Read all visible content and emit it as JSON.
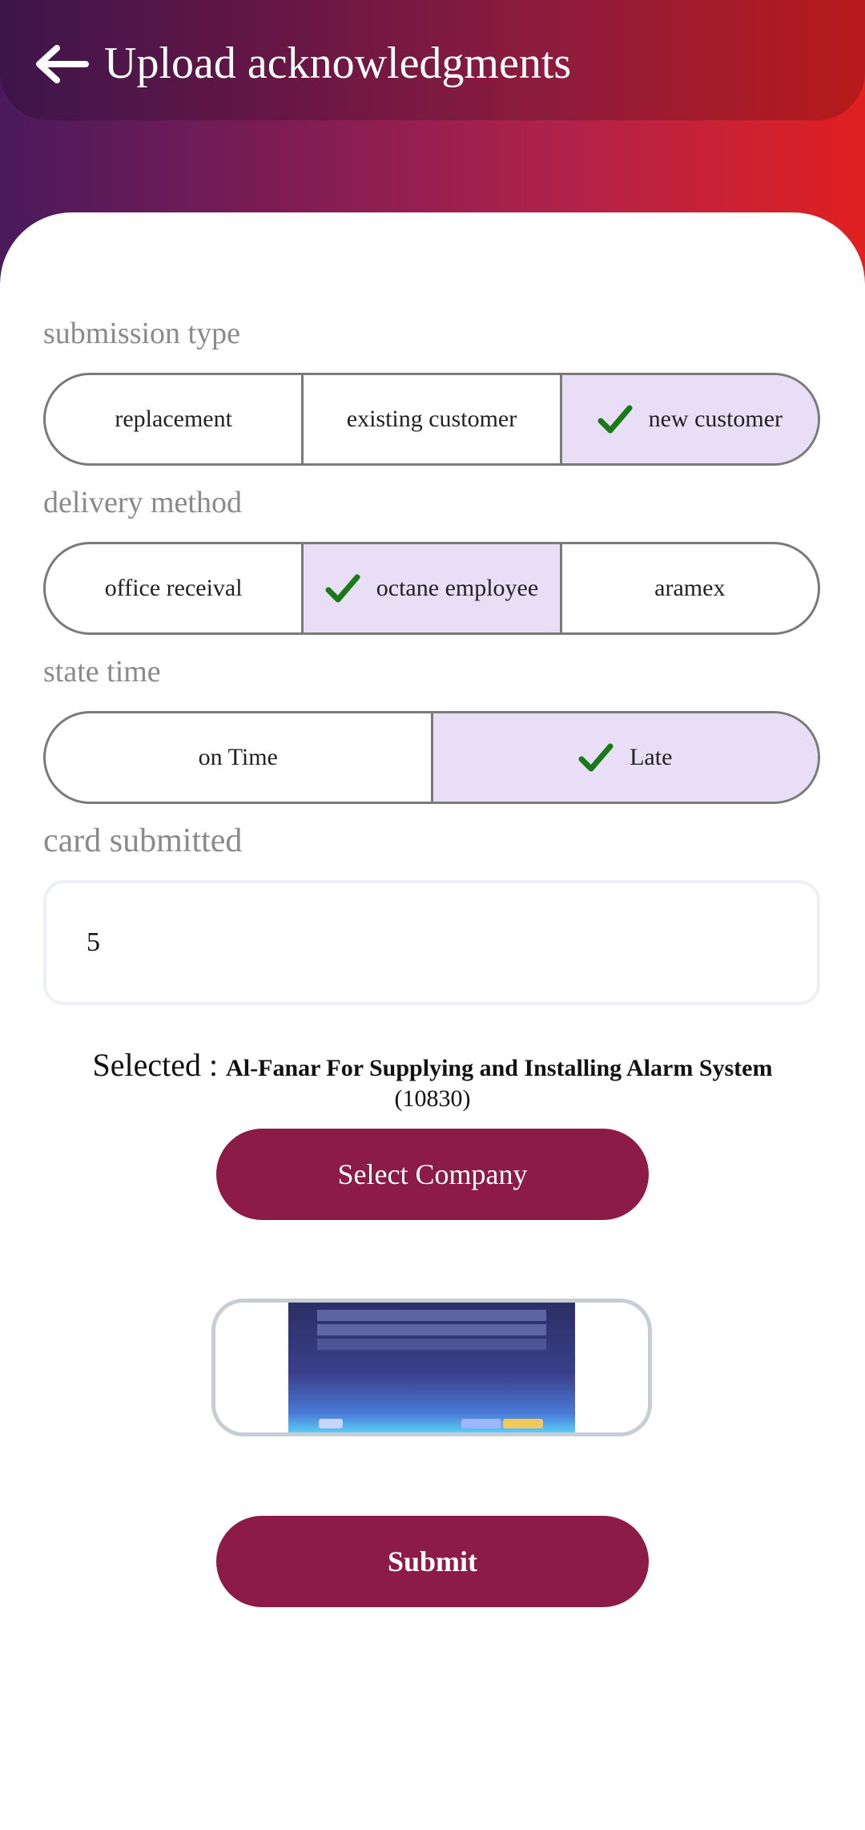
{
  "header": {
    "title": "Upload acknowledgments"
  },
  "icons": {
    "back": "arrow-left-icon",
    "check": "check-icon"
  },
  "submission_type": {
    "label": "submission type",
    "options": [
      "replacement",
      "existing customer",
      "new customer"
    ],
    "selected": "new customer"
  },
  "delivery_method": {
    "label": "delivery method",
    "options": [
      "office receival",
      "octane employee",
      "aramex"
    ],
    "selected": "octane employee"
  },
  "state_time": {
    "label": "state time",
    "options": [
      "on Time",
      "Late"
    ],
    "selected": "Late"
  },
  "card_submitted": {
    "label": "card submitted",
    "value": "5"
  },
  "selection": {
    "prefix": "Selected : ",
    "company": "Al-Fanar For Supplying and Installing Alarm System",
    "code": "(10830)"
  },
  "buttons": {
    "select_company": "Select Company",
    "submit": "Submit"
  },
  "colors": {
    "accent": "#8c1b48",
    "selected_segment": "#e8def5",
    "check": "#1a7a1a",
    "header_gradient_start": "#4a1a5c",
    "header_gradient_end": "#e02020"
  }
}
